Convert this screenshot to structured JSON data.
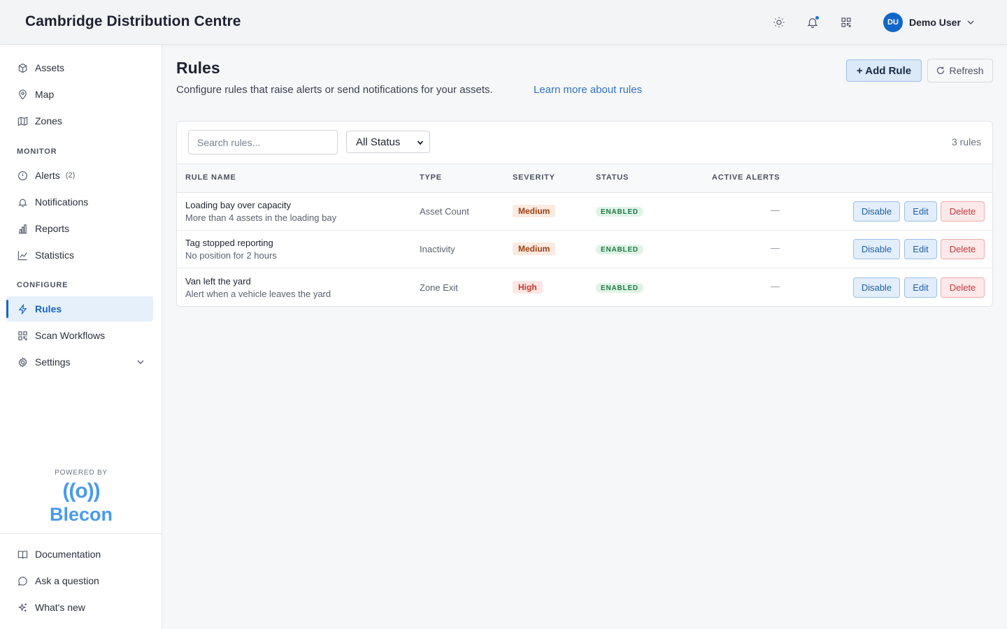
{
  "header": {
    "title": "Cambridge Distribution Centre",
    "user_initials": "DU",
    "user_name": "Demo User"
  },
  "sidebar": {
    "top_items": [
      {
        "label": "Assets",
        "icon": "box-icon"
      },
      {
        "label": "Map",
        "icon": "map-pin-icon"
      },
      {
        "label": "Zones",
        "icon": "map-icon"
      }
    ],
    "monitor_label": "MONITOR",
    "monitor_items": [
      {
        "label": "Alerts",
        "icon": "alert-circle-icon",
        "count": "(2)"
      },
      {
        "label": "Notifications",
        "icon": "bell-icon"
      },
      {
        "label": "Reports",
        "icon": "bar-chart-icon"
      },
      {
        "label": "Statistics",
        "icon": "line-chart-icon"
      }
    ],
    "configure_label": "CONFIGURE",
    "configure_items": [
      {
        "label": "Rules",
        "icon": "lightning-icon",
        "active": true
      },
      {
        "label": "Scan Workflows",
        "icon": "qr-code-icon"
      },
      {
        "label": "Settings",
        "icon": "gear-icon"
      }
    ],
    "powered_by": "POWERED BY",
    "brand_mark": "((o))",
    "brand_name": "Blecon",
    "footer_items": [
      {
        "label": "Documentation",
        "icon": "book-icon"
      },
      {
        "label": "Ask a question",
        "icon": "chat-bubble-icon"
      },
      {
        "label": "What's new",
        "icon": "sparkle-icon"
      }
    ]
  },
  "main": {
    "title": "Rules",
    "description": "Configure rules that raise alerts or send notifications for your assets.",
    "learn_more": "Learn more about rules",
    "add_button": "+ Add Rule",
    "refresh_button": "Refresh",
    "search_placeholder": "Search rules...",
    "status_filter": "All Status",
    "rule_count": "3 rules",
    "columns": [
      "RULE NAME",
      "TYPE",
      "SEVERITY",
      "STATUS",
      "ACTIVE ALERTS"
    ],
    "rules": [
      {
        "name": "Loading bay over capacity",
        "description": "More than 4 assets in the loading bay",
        "type": "Asset Count",
        "severity": "Medium",
        "status": "ENABLED",
        "active_alerts": "—"
      },
      {
        "name": "Tag stopped reporting",
        "description": "No position for 2 hours",
        "type": "Inactivity",
        "severity": "Medium",
        "status": "ENABLED",
        "active_alerts": "—"
      },
      {
        "name": "Van left the yard",
        "description": "Alert when a vehicle leaves the yard",
        "type": "Zone Exit",
        "severity": "High",
        "status": "ENABLED",
        "active_alerts": "—"
      }
    ],
    "actions": {
      "disable": "Disable",
      "edit": "Edit",
      "delete": "Delete"
    }
  }
}
